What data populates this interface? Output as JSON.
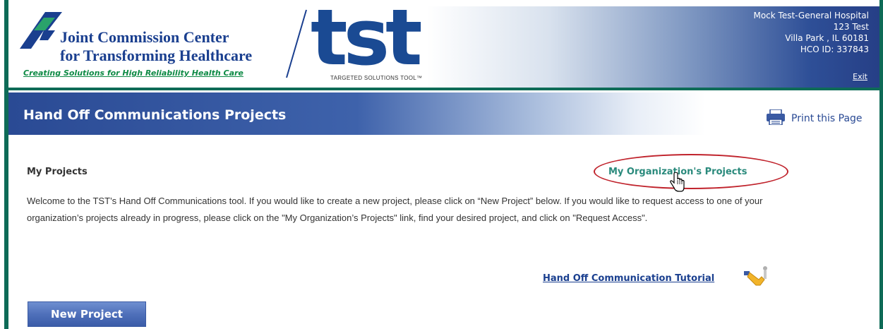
{
  "header": {
    "org_line1": "Joint Commission Center",
    "org_line2": "for Transforming Healthcare",
    "tagline": "Creating Solutions for High Reliability Health Care",
    "tst_logo": "tst",
    "tst_subtitle": "TARGETED SOLUTIONS TOOL™",
    "hco_name": "Mock Test-General Hospital",
    "hco_address": "123 Test",
    "hco_city": "Villa Park , IL 60181",
    "hco_id": "HCO ID: 337843",
    "exit_label": "Exit"
  },
  "banner": {
    "title": "Hand Off Communications Projects",
    "print_label": "Print this Page",
    "print_icon": "printer-icon"
  },
  "main": {
    "section_title": "My Projects",
    "org_projects_link": "My Organization's Projects",
    "welcome_text": "Welcome to the TST’s Hand Off Communications tool. If you would like to create a new project, please click on “New Project” below. If you would like to request access to one of your organization’s projects already in progress, please click on the \"My Organization’s Projects\" link, find your desired project, and click on \"Request Access\".",
    "tutorial_link": "Hand Off Communication Tutorial",
    "tutorial_icon": "handoff-tutorial-icon",
    "new_project_button": "New Project"
  },
  "colors": {
    "brand_blue": "#1a3f8f",
    "brand_green": "#0e6b57",
    "link_teal": "#2a8a7c",
    "highlight_red": "#c0232c"
  }
}
